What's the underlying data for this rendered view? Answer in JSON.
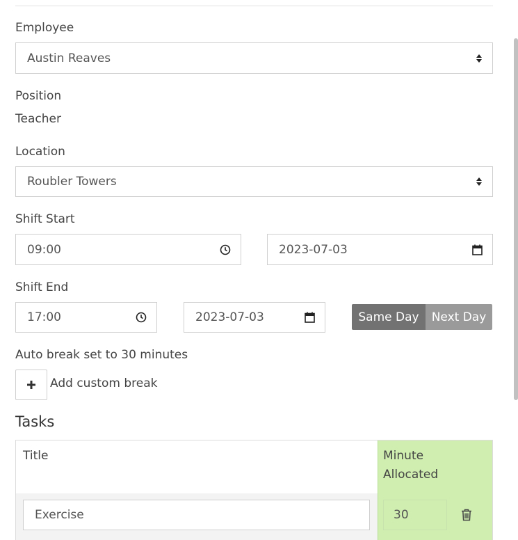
{
  "form": {
    "employee": {
      "label": "Employee",
      "value": "Austin Reaves"
    },
    "position": {
      "label": "Position",
      "value": "Teacher"
    },
    "location": {
      "label": "Location",
      "value": "Roubler Towers"
    },
    "shift_start": {
      "label": "Shift Start",
      "time": "09:00",
      "date": "2023-07-03"
    },
    "shift_end": {
      "label": "Shift End",
      "time": "17:00",
      "date": "2023-07-03",
      "same_day_label": "Same Day",
      "next_day_label": "Next Day"
    },
    "auto_break_text": "Auto break set to 30 minutes",
    "add_custom_break_label": "Add custom break"
  },
  "tasks": {
    "heading": "Tasks",
    "columns": [
      "Title",
      "Minute Allocated"
    ],
    "rows": [
      {
        "title": "Exercise",
        "minutes": "30"
      }
    ]
  },
  "colors": {
    "highlight": "#cfeeb0",
    "same_day_bg": "#727272",
    "next_day_bg": "#9a9a9a"
  },
  "icons": {
    "select": "sort-arrows-icon",
    "time": "clock-icon",
    "date": "calendar-icon",
    "add": "plus-icon",
    "delete": "trash-icon"
  }
}
